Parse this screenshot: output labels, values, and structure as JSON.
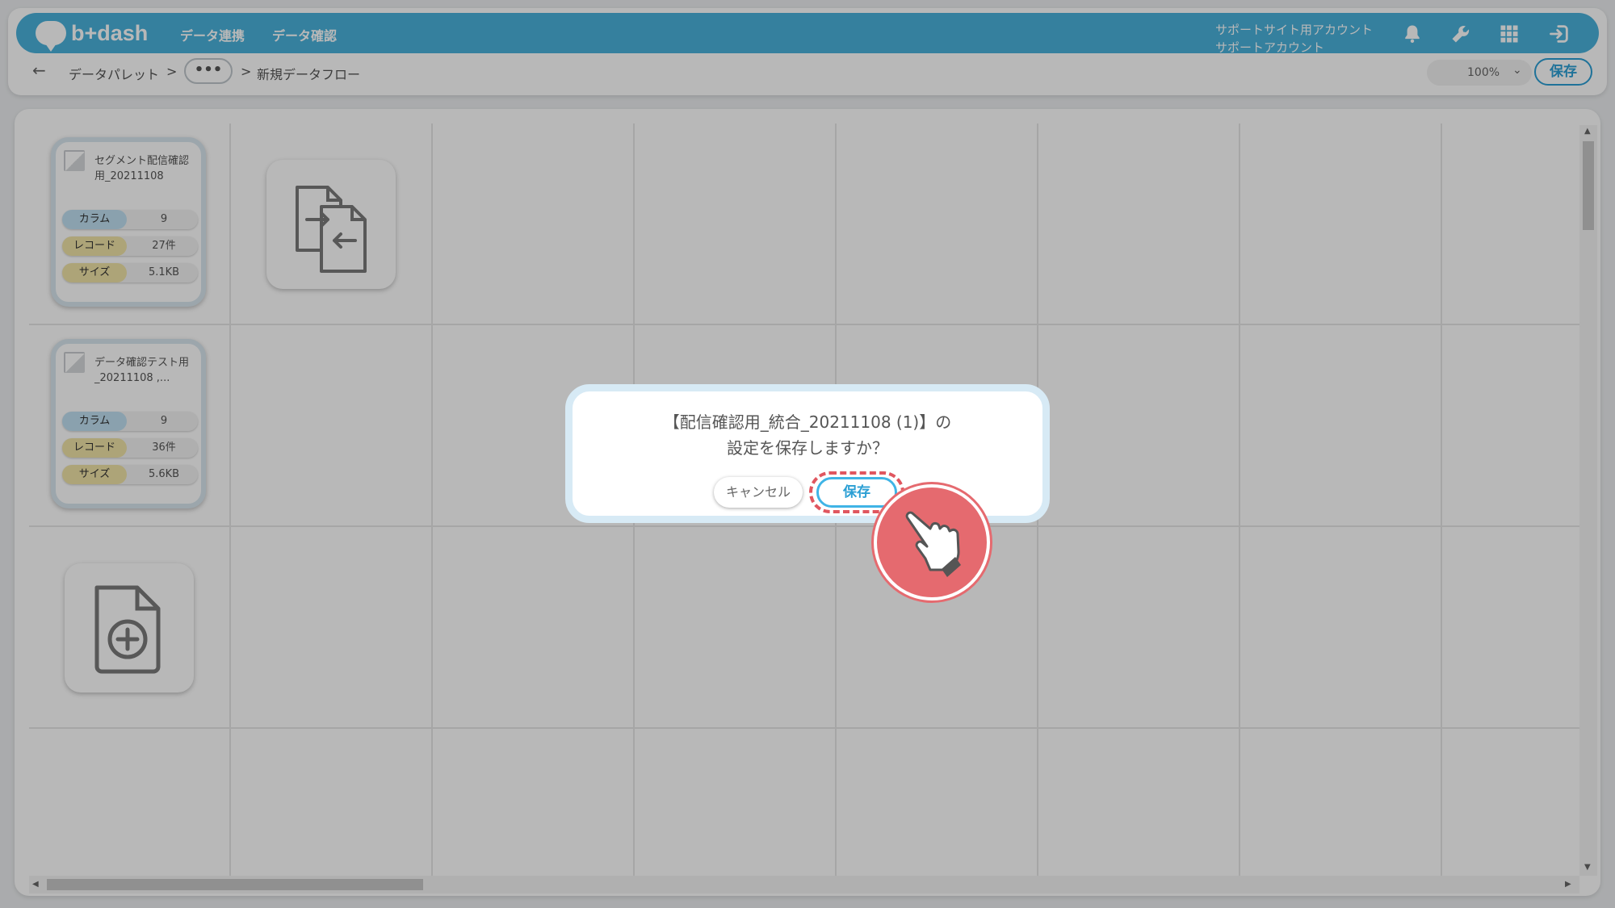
{
  "header": {
    "logo_text": "b+dash",
    "nav": [
      "データ連携",
      "データ確認"
    ],
    "account": [
      "サポートサイト用アカウント",
      "サポートアカウント"
    ]
  },
  "breadcrumb": {
    "back_icon": "arrow-left-icon",
    "root": "データパレット",
    "sep1": ">",
    "ellipsis": "•••",
    "sep2": ">",
    "current": "新規データフロー"
  },
  "toolbar": {
    "zoom": "100%",
    "zoom_chevron": "⌄",
    "save_label": "保存"
  },
  "data_cards": [
    {
      "name": "セグメント配信確認用_20211108",
      "stats": [
        {
          "key": "カラム",
          "value": "9"
        },
        {
          "key": "レコード",
          "value": "27件"
        },
        {
          "key": "サイズ",
          "value": "5.1KB"
        }
      ]
    },
    {
      "name": "データ確認テスト用_20211108 ,...",
      "stats": [
        {
          "key": "カラム",
          "value": "9"
        },
        {
          "key": "レコード",
          "value": "36件"
        },
        {
          "key": "サイズ",
          "value": "5.6KB"
        }
      ]
    }
  ],
  "dialog": {
    "message_line1": "【配信確認用_統合_20211108 (1)】の",
    "message_line2": "設定を保存しますか？",
    "cancel_label": "キャンセル",
    "save_label": "保存"
  },
  "icons": {
    "bell": "bell-icon",
    "wrench": "wrench-icon",
    "apps": "grid-apps-icon",
    "logout": "logout-icon",
    "merge": "file-merge-icon",
    "add_file": "file-add-icon",
    "hand": "hand-pointer-icon"
  },
  "colors": {
    "header": "#4ab2db",
    "accent": "#2b9fd4",
    "highlight": "#e0565f"
  }
}
